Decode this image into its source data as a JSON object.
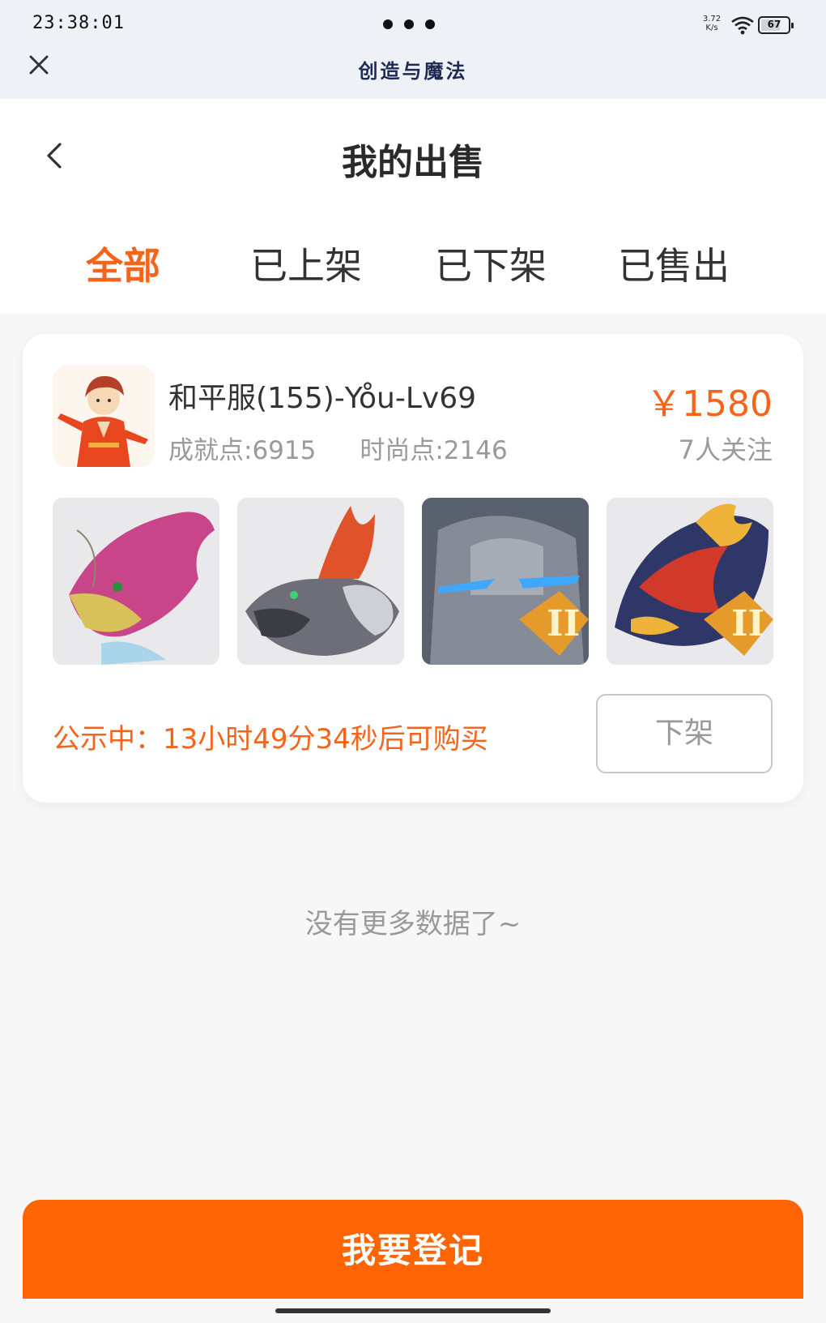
{
  "status_bar": {
    "time": "23:38:01",
    "net_speed": "3.72\nK/s",
    "battery": "67"
  },
  "app": {
    "title": "创造与魔法"
  },
  "page": {
    "title": "我的出售"
  },
  "tabs": [
    {
      "label": "全部",
      "active": true
    },
    {
      "label": "已上架",
      "active": false
    },
    {
      "label": "已下架",
      "active": false
    },
    {
      "label": "已售出",
      "active": false
    }
  ],
  "listing": {
    "name": "和平服(155)-Yo̊u-Lv69",
    "achievement": "成就点:6915",
    "fashion": "时尚点:2146",
    "price": "￥1580",
    "followers": "7人关注",
    "thumbnails": [
      "pink-dragon-mount",
      "gray-dragon-mount",
      "stone-golem-mount",
      "fire-dragon-mount"
    ],
    "notice": "公示中：13小时49分34秒后可购买",
    "delist_label": "下架"
  },
  "footer": {
    "no_more": "没有更多数据了~",
    "register_label": "我要登记"
  },
  "colors": {
    "accent": "#f4641a",
    "button": "#ff6405",
    "muted": "#9a9a9a"
  }
}
